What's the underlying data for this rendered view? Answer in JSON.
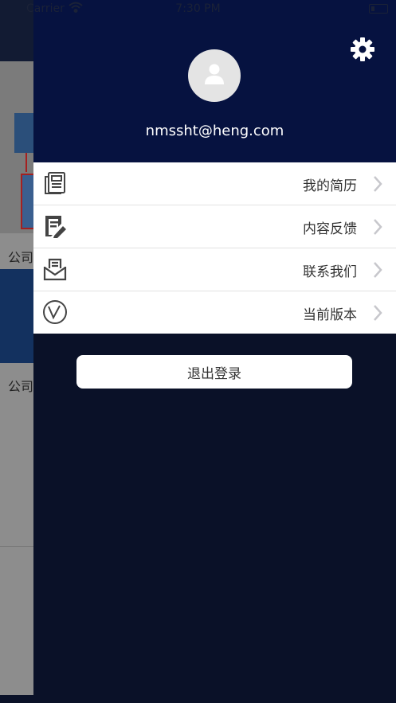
{
  "status_bar": {
    "carrier": "Carrier",
    "time": "7:30 PM",
    "wifi_icon": "wifi-icon",
    "battery_icon": "battery-icon"
  },
  "background_app": {
    "labels": [
      "公司",
      "公司"
    ]
  },
  "drawer": {
    "settings_icon": "gear-icon",
    "avatar_icon": "user-avatar-icon",
    "email": "nmssht@heng.com",
    "menu": [
      {
        "label": "我的简历",
        "icon": "resume-icon"
      },
      {
        "label": "内容反馈",
        "icon": "feedback-edit-icon"
      },
      {
        "label": "联系我们",
        "icon": "contact-inbox-icon"
      },
      {
        "label": "当前版本",
        "icon": "version-icon"
      }
    ],
    "logout_label": "退出登录"
  },
  "colors": {
    "drawer_header": "#061240",
    "drawer_body": "#0a1128",
    "menu_background": "#ffffff",
    "text_primary": "#333333",
    "chevron": "#c7c7cc",
    "icon": "#444444"
  }
}
